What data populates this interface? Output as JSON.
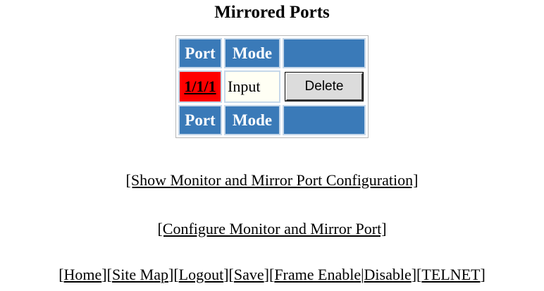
{
  "title": "Mirrored Ports",
  "table": {
    "header_top": {
      "port": "Port",
      "mode": "Mode",
      "action": ""
    },
    "rows": [
      {
        "port": "1/1/1",
        "mode": "Input",
        "action_label": "Delete"
      }
    ],
    "header_bottom": {
      "port": "Port",
      "mode": "Mode",
      "action": ""
    }
  },
  "links": {
    "show": "[Show Monitor and Mirror Port Configuration]",
    "configure": "[Configure Monitor and Mirror Port]"
  },
  "footer": {
    "open1": "[",
    "home": "Home",
    "b1": "][",
    "site_map": "Site Map",
    "b2": "][",
    "logout": "Logout",
    "b3": "][",
    "save": "Save",
    "b4": "][",
    "frame_enable": "Frame Enable",
    "pipe": "|",
    "disable": "Disable",
    "b5": "][",
    "telnet": "TELNET",
    "close": "]"
  },
  "colors": {
    "header_bg": "#3a7ab8",
    "port_highlight": "#ff0000",
    "mode_bg": "#fffff4"
  }
}
